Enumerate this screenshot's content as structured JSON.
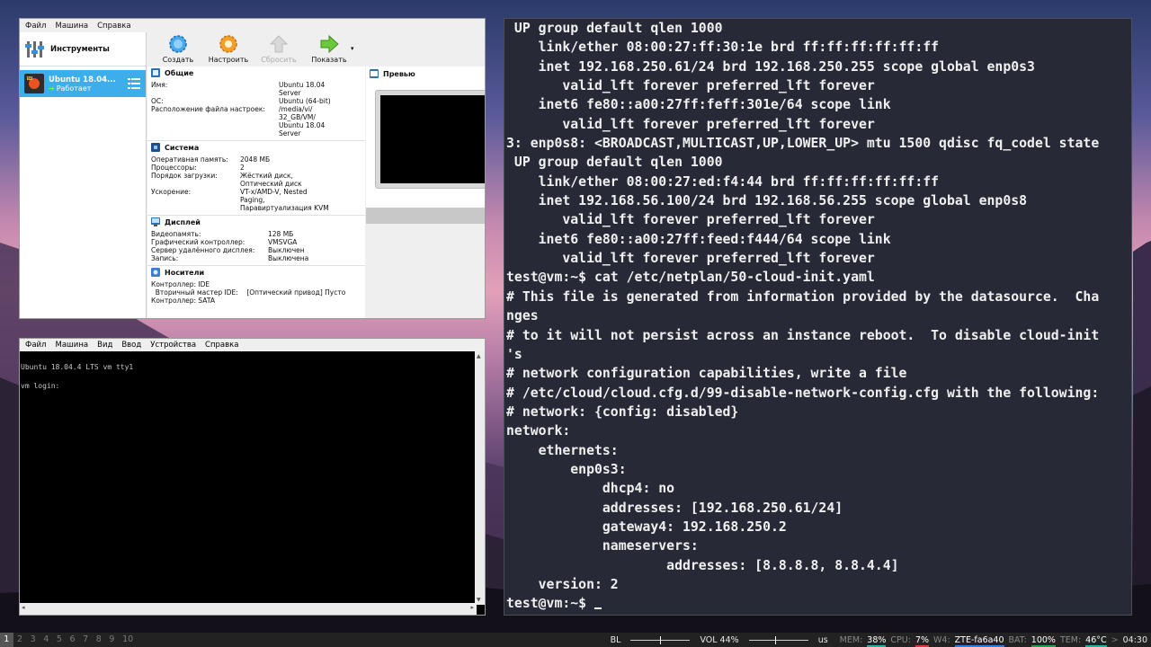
{
  "vbox_manager": {
    "menu": [
      "Файл",
      "Машина",
      "Справка"
    ],
    "tools_label": "Инструменты",
    "vm": {
      "name": "Ubuntu 18.04...",
      "state": "Работает"
    },
    "toolbar": {
      "create": "Создать",
      "settings": "Настроить",
      "discard": "Сбросить",
      "show": "Показать"
    },
    "general": {
      "title": "Общие",
      "rows": [
        {
          "k": "Имя:",
          "v": "Ubuntu 18.04\nServer"
        },
        {
          "k": "ОС:",
          "v": "Ubuntu (64-bit)"
        },
        {
          "k": "Расположение файла настроек:",
          "v": "/media/vi/\n32_GB/VM/\nUbuntu 18.04\nServer"
        }
      ]
    },
    "system": {
      "title": "Система",
      "rows": [
        {
          "k": "Оперативная память:",
          "v": "2048 МБ"
        },
        {
          "k": "Процессоры:",
          "v": "2"
        },
        {
          "k": "Порядок загрузки:",
          "v": "Жёсткий диск,\nОптический диск"
        },
        {
          "k": "Ускорение:",
          "v": "VT-x/AMD-V, Nested\nPaging,\nПаравиртуализация KVM"
        }
      ]
    },
    "display": {
      "title": "Дисплей",
      "rows": [
        {
          "k": "Видеопамять:",
          "v": "128 МБ"
        },
        {
          "k": "Графический контроллер:",
          "v": "VMSVGA"
        },
        {
          "k": "Сервер удалённого дисплея:",
          "v": "Выключен"
        },
        {
          "k": "Запись:",
          "v": "Выключена"
        }
      ]
    },
    "storage": {
      "title": "Носители",
      "lines": [
        "Контроллер: IDE",
        "  Вторичный мастер IDE:    [Оптический привод] Пусто",
        "Контроллер: SATA"
      ]
    },
    "preview": {
      "title": "Превью"
    }
  },
  "vm_console": {
    "menu": [
      "Файл",
      "Машина",
      "Вид",
      "Ввод",
      "Устройства",
      "Справка"
    ],
    "lines": [
      "Ubuntu 18.04.4 LTS vm tty1",
      "vm login:"
    ]
  },
  "terminal": {
    "lines": [
      " UP group default qlen 1000",
      "    link/ether 08:00:27:ff:30:1e brd ff:ff:ff:ff:ff:ff",
      "    inet 192.168.250.61/24 brd 192.168.250.255 scope global enp0s3",
      "       valid_lft forever preferred_lft forever",
      "    inet6 fe80::a00:27ff:feff:301e/64 scope link",
      "       valid_lft forever preferred_lft forever",
      "3: enp0s8: <BROADCAST,MULTICAST,UP,LOWER_UP> mtu 1500 qdisc fq_codel state",
      " UP group default qlen 1000",
      "    link/ether 08:00:27:ed:f4:44 brd ff:ff:ff:ff:ff:ff",
      "    inet 192.168.56.100/24 brd 192.168.56.255 scope global enp0s8",
      "       valid_lft forever preferred_lft forever",
      "    inet6 fe80::a00:27ff:feed:f444/64 scope link",
      "       valid_lft forever preferred_lft forever",
      "test@vm:~$ cat /etc/netplan/50-cloud-init.yaml",
      "# This file is generated from information provided by the datasource.  Cha",
      "nges",
      "# to it will not persist across an instance reboot.  To disable cloud-init",
      "'s",
      "# network configuration capabilities, write a file",
      "# /etc/cloud/cloud.cfg.d/99-disable-network-config.cfg with the following:",
      "# network: {config: disabled}",
      "network:",
      "    ethernets:",
      "        enp0s3:",
      "            dhcp4: no",
      "            addresses: [192.168.250.61/24]",
      "            gateway4: 192.168.250.2",
      "            nameservers:",
      "                    addresses: [8.8.8.8, 8.8.4.4]",
      "    version: 2"
    ],
    "prompt": "test@vm:~$ "
  },
  "statusbar": {
    "workspaces": [
      "1",
      "2",
      "3",
      "4",
      "5",
      "6",
      "7",
      "8",
      "9",
      "10"
    ],
    "active_workspace": "1",
    "backlight_label": "BL",
    "backlight_level": 0.5,
    "volume_label": "VOL 44%",
    "volume_level": 0.44,
    "keyboard": "us",
    "mem_label": "MEM:",
    "mem_value": "38%",
    "cpu_label": "CPU:",
    "cpu_value": "7%",
    "wifi_label": "W4:",
    "wifi_value": "ZTE-fa6a40",
    "bat_label": "BAT:",
    "bat_value": "100%",
    "temp_label": "TEM:",
    "temp_value": "46°C",
    "clock": "04:30",
    "colors": {
      "mem": "#2fa8a0",
      "cpu": "#d33a3a",
      "wifi": "#2f7fd0",
      "bat": "#2a9a4a",
      "temp": "#2fa8a0"
    }
  }
}
